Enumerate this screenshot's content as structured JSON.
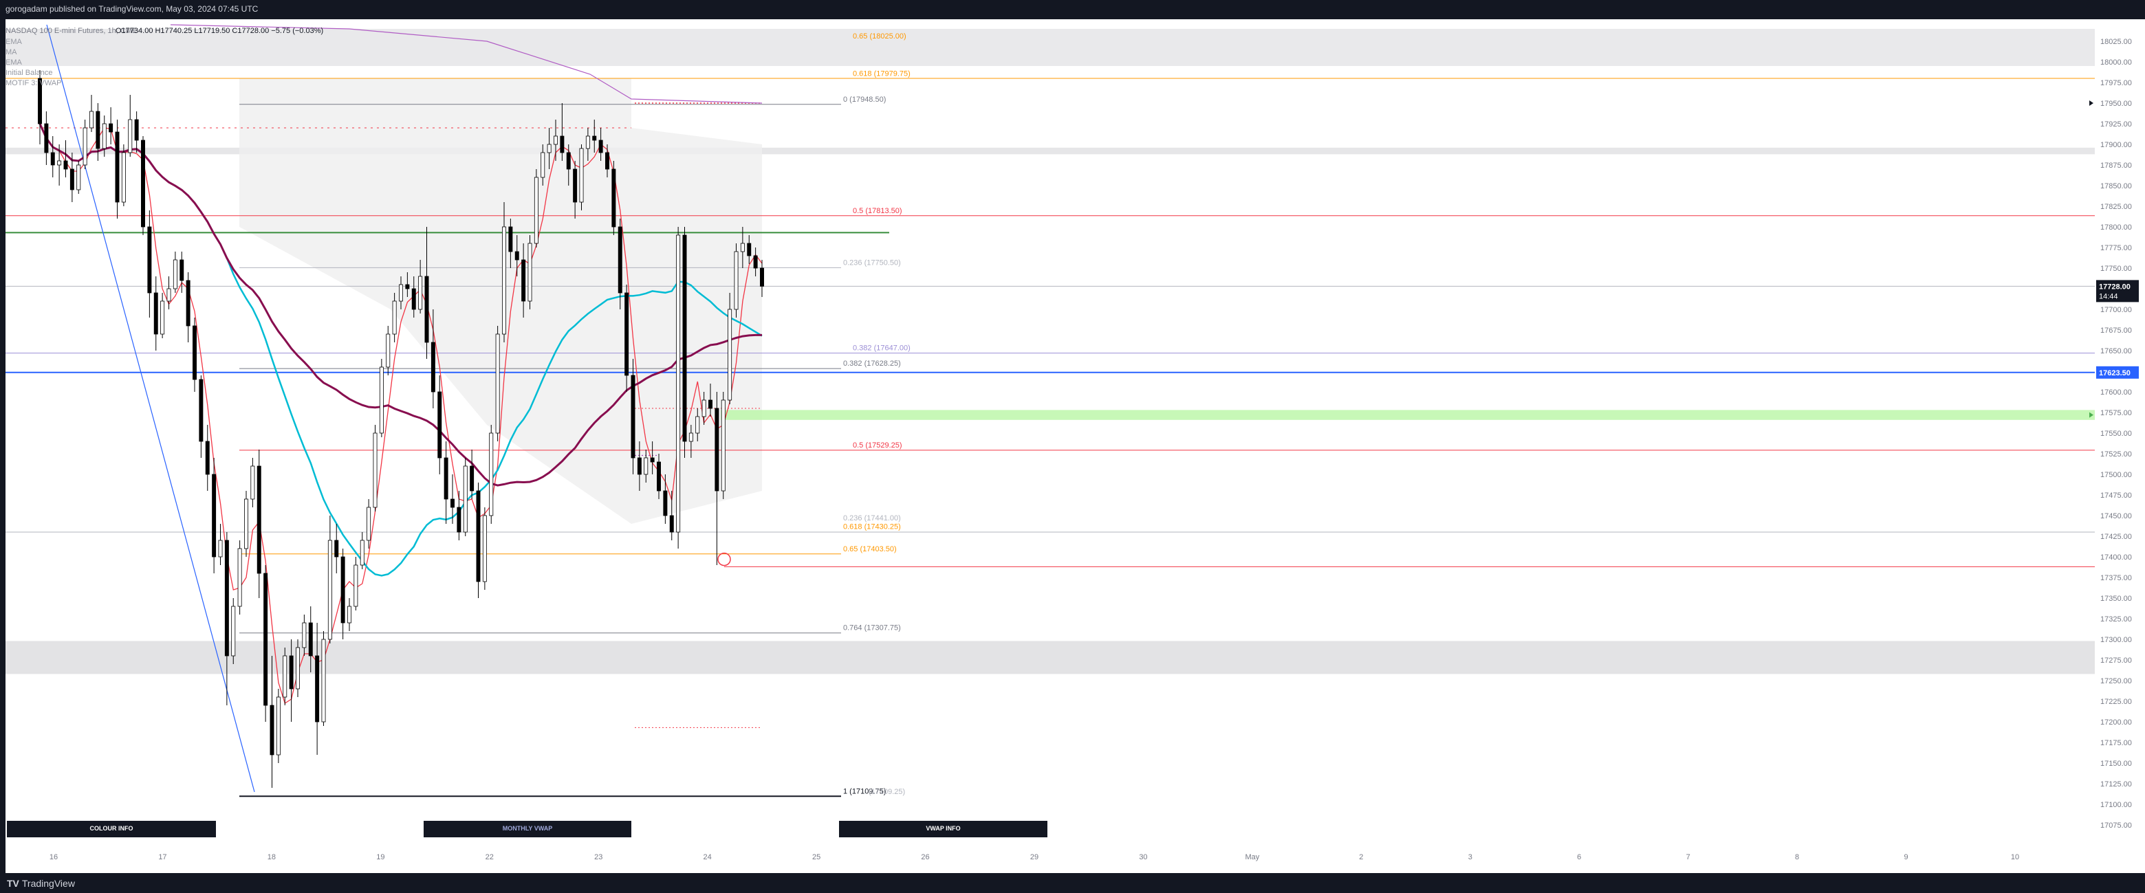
{
  "header": {
    "publish_text": "gorogadam published on TradingView.com, May 03, 2024 07:45 UTC"
  },
  "footer": {
    "brand": "TradingView",
    "brand_mark": "TV"
  },
  "chart_data": {
    "type": "candlestick",
    "title": "NASDAQ 100 E-mini Futures, 1h, CME",
    "ohlc": {
      "open_label": "O",
      "open": "17734.00",
      "high_label": "H",
      "high": "17740.25",
      "low_label": "L",
      "low": "17719.50",
      "close_label": "C",
      "close": "17728.00",
      "change": "−5.75 (−0.03%)"
    },
    "indicator_legend": [
      "EMA",
      "MA",
      "EMA",
      "Initial Balance",
      "MOTIF 3: VWAP"
    ],
    "y_axis": {
      "ticks": [
        "18025.00",
        "18000.00",
        "17975.00",
        "17950.00",
        "17925.00",
        "17900.00",
        "17875.00",
        "17850.00",
        "17825.00",
        "17800.00",
        "17775.00",
        "17750.00",
        "17725.00",
        "17700.00",
        "17675.00",
        "17650.00",
        "17625.00",
        "17600.00",
        "17575.00",
        "17550.00",
        "17525.00",
        "17500.00",
        "17475.00",
        "17450.00",
        "17425.00",
        "17400.00",
        "17375.00",
        "17350.00",
        "17325.00",
        "17300.00",
        "17275.00",
        "17250.00",
        "17225.00",
        "17200.00",
        "17175.00",
        "17150.00",
        "17125.00",
        "17100.00",
        "17075.00"
      ],
      "range": [
        17065,
        18045
      ]
    },
    "x_axis": {
      "ticks": [
        "16",
        "17",
        "18",
        "19",
        "22",
        "23",
        "24",
        "25",
        "26",
        "29",
        "30",
        "May",
        "2",
        "3",
        "6",
        "7",
        "8",
        "9",
        "10"
      ]
    },
    "price_badges": {
      "last_price": "17728.00",
      "countdown": "14:44",
      "level_price": "17623.50"
    },
    "colors": {
      "up_candle": "#ffffff",
      "down_candle": "#000000",
      "candle_outline": "#000000",
      "ema_fast": "#f23645",
      "ma_cyan": "#00bcd4",
      "ema_purple": "#880e4f",
      "vwap_band": "#9c27b0",
      "fib_gray": "#787b86",
      "fib_red": "#f23645",
      "fib_orange": "#ff9800",
      "blue_level": "#2962ff",
      "green_level": "#388e3c"
    },
    "fib_labels": [
      {
        "text": "0.65 (18025.00)",
        "price": 18025.0,
        "color": "#ff9800"
      },
      {
        "text": "0.618 (17979.75)",
        "price": 17979.75,
        "color": "#ff9800"
      },
      {
        "text": "0 (17948.50)",
        "price": 17948.5,
        "color": "#787b86"
      },
      {
        "text": "0.5 (17813.50)",
        "price": 17813.5,
        "color": "#f23645"
      },
      {
        "text": "0.236 (17750.50)",
        "price": 17750.5,
        "color": "#b2b5be"
      },
      {
        "text": "0.382 (17647.00)",
        "price": 17647.0,
        "color": "#9c8fd6"
      },
      {
        "text": "0.382 (17628.25)",
        "price": 17628.25,
        "color": "#787b86"
      },
      {
        "text": "0.5 (17529.25)",
        "price": 17529.25,
        "color": "#f23645"
      },
      {
        "text": "0.236 (17441.00)",
        "price": 17441.0,
        "color": "#b2b5be"
      },
      {
        "text": "0.618 (17430.25)",
        "price": 17430.25,
        "color": "#ff9800"
      },
      {
        "text": "0.65 (17403.50)",
        "price": 17403.5,
        "color": "#ff9800"
      },
      {
        "text": "0.764 (17307.75)",
        "price": 17307.75,
        "color": "#787b86"
      },
      {
        "text": "1 (17109.75)",
        "price": 17109.75,
        "color": "#131722"
      },
      {
        "text": "(17109.25)",
        "price": 17109.25,
        "color": "#b2b5be"
      }
    ],
    "info_buttons": [
      "COLOUR INFO",
      "MONTHLY VWAP",
      "VWAP INFO"
    ],
    "candles": [
      [
        17980,
        17990,
        17900,
        17925
      ],
      [
        17925,
        17940,
        17875,
        17890
      ],
      [
        17890,
        17910,
        17860,
        17875
      ],
      [
        17875,
        17900,
        17850,
        17880
      ],
      [
        17880,
        17905,
        17860,
        17870
      ],
      [
        17870,
        17890,
        17830,
        17845
      ],
      [
        17845,
        17880,
        17840,
        17875
      ],
      [
        17875,
        17930,
        17870,
        17920
      ],
      [
        17920,
        17960,
        17915,
        17940
      ],
      [
        17940,
        17950,
        17880,
        17895
      ],
      [
        17895,
        17935,
        17885,
        17925
      ],
      [
        17925,
        17945,
        17900,
        17915
      ],
      [
        17915,
        17930,
        17810,
        17830
      ],
      [
        17830,
        17900,
        17825,
        17890
      ],
      [
        17890,
        17960,
        17885,
        17930
      ],
      [
        17930,
        17940,
        17890,
        17905
      ],
      [
        17905,
        17910,
        17790,
        17800
      ],
      [
        17800,
        17820,
        17690,
        17720
      ],
      [
        17720,
        17740,
        17650,
        17670
      ],
      [
        17670,
        17720,
        17665,
        17710
      ],
      [
        17710,
        17740,
        17700,
        17725
      ],
      [
        17725,
        17770,
        17720,
        17760
      ],
      [
        17760,
        17770,
        17720,
        17735
      ],
      [
        17735,
        17745,
        17660,
        17680
      ],
      [
        17680,
        17690,
        17600,
        17615
      ],
      [
        17615,
        17620,
        17520,
        17540
      ],
      [
        17540,
        17560,
        17480,
        17500
      ],
      [
        17500,
        17520,
        17380,
        17400
      ],
      [
        17400,
        17440,
        17390,
        17420
      ],
      [
        17420,
        17430,
        17220,
        17280
      ],
      [
        17280,
        17350,
        17270,
        17340
      ],
      [
        17340,
        17420,
        17330,
        17410
      ],
      [
        17410,
        17480,
        17400,
        17470
      ],
      [
        17470,
        17520,
        17460,
        17510
      ],
      [
        17510,
        17530,
        17350,
        17380
      ],
      [
        17380,
        17390,
        17200,
        17220
      ],
      [
        17220,
        17280,
        17120,
        17160
      ],
      [
        17160,
        17240,
        17150,
        17230
      ],
      [
        17230,
        17290,
        17220,
        17280
      ],
      [
        17280,
        17300,
        17200,
        17240
      ],
      [
        17240,
        17300,
        17230,
        17290
      ],
      [
        17290,
        17330,
        17280,
        17320
      ],
      [
        17320,
        17340,
        17260,
        17280
      ],
      [
        17280,
        17320,
        17160,
        17200
      ],
      [
        17200,
        17310,
        17195,
        17300
      ],
      [
        17300,
        17450,
        17295,
        17420
      ],
      [
        17420,
        17440,
        17380,
        17400
      ],
      [
        17400,
        17410,
        17300,
        17320
      ],
      [
        17320,
        17350,
        17310,
        17340
      ],
      [
        17340,
        17400,
        17335,
        17390
      ],
      [
        17390,
        17430,
        17385,
        17420
      ],
      [
        17420,
        17470,
        17410,
        17460
      ],
      [
        17460,
        17560,
        17455,
        17550
      ],
      [
        17550,
        17640,
        17545,
        17630
      ],
      [
        17630,
        17680,
        17620,
        17670
      ],
      [
        17670,
        17720,
        17660,
        17710
      ],
      [
        17710,
        17740,
        17700,
        17730
      ],
      [
        17730,
        17745,
        17715,
        17725
      ],
      [
        17725,
        17740,
        17690,
        17700
      ],
      [
        17700,
        17760,
        17695,
        17740
      ],
      [
        17740,
        17800,
        17640,
        17660
      ],
      [
        17660,
        17700,
        17580,
        17600
      ],
      [
        17600,
        17620,
        17500,
        17520
      ],
      [
        17520,
        17540,
        17440,
        17470
      ],
      [
        17470,
        17500,
        17440,
        17460
      ],
      [
        17460,
        17480,
        17420,
        17430
      ],
      [
        17430,
        17520,
        17425,
        17510
      ],
      [
        17510,
        17530,
        17470,
        17480
      ],
      [
        17480,
        17490,
        17350,
        17370
      ],
      [
        17370,
        17460,
        17360,
        17450
      ],
      [
        17450,
        17560,
        17440,
        17550
      ],
      [
        17550,
        17680,
        17540,
        17670
      ],
      [
        17670,
        17830,
        17660,
        17800
      ],
      [
        17800,
        17810,
        17750,
        17770
      ],
      [
        17770,
        17790,
        17740,
        17760
      ],
      [
        17760,
        17780,
        17690,
        17710
      ],
      [
        17710,
        17790,
        17700,
        17780
      ],
      [
        17780,
        17870,
        17775,
        17860
      ],
      [
        17860,
        17900,
        17850,
        17890
      ],
      [
        17890,
        17920,
        17870,
        17900
      ],
      [
        17900,
        17930,
        17880,
        17910
      ],
      [
        17910,
        17950,
        17880,
        17890
      ],
      [
        17890,
        17900,
        17850,
        17870
      ],
      [
        17870,
        17880,
        17810,
        17830
      ],
      [
        17830,
        17900,
        17820,
        17895
      ],
      [
        17895,
        17920,
        17880,
        17910
      ],
      [
        17910,
        17930,
        17890,
        17905
      ],
      [
        17905,
        17920,
        17880,
        17890
      ],
      [
        17890,
        17900,
        17860,
        17870
      ],
      [
        17870,
        17880,
        17790,
        17800
      ],
      [
        17800,
        17810,
        17700,
        17720
      ],
      [
        17720,
        17730,
        17600,
        17620
      ],
      [
        17620,
        17640,
        17500,
        17520
      ],
      [
        17520,
        17540,
        17480,
        17500
      ],
      [
        17500,
        17530,
        17490,
        17520
      ],
      [
        17520,
        17540,
        17500,
        17515
      ],
      [
        17515,
        17525,
        17470,
        17480
      ],
      [
        17480,
        17500,
        17440,
        17450
      ],
      [
        17450,
        17480,
        17420,
        17430
      ],
      [
        17430,
        17800,
        17410,
        17790
      ],
      [
        17790,
        17800,
        17520,
        17540
      ],
      [
        17540,
        17560,
        17520,
        17550
      ],
      [
        17550,
        17580,
        17540,
        17570
      ],
      [
        17570,
        17600,
        17560,
        17590
      ],
      [
        17590,
        17610,
        17570,
        17580
      ],
      [
        17580,
        17600,
        17390,
        17480
      ],
      [
        17480,
        17600,
        17470,
        17590
      ],
      [
        17590,
        17720,
        17585,
        17700
      ],
      [
        17700,
        17780,
        17690,
        17770
      ],
      [
        17770,
        17800,
        17750,
        17780
      ],
      [
        17780,
        17790,
        17755,
        17765
      ],
      [
        17765,
        17775,
        17740,
        17750
      ],
      [
        17750,
        17760,
        17715,
        17728
      ]
    ]
  }
}
